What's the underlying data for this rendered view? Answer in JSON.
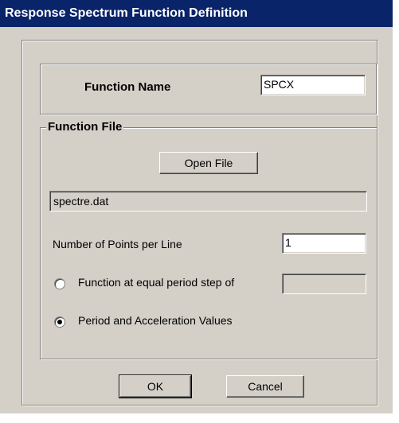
{
  "window": {
    "title": "Response Spectrum Function Definition"
  },
  "function_name": {
    "label": "Function Name",
    "value": "SPCX"
  },
  "function_file": {
    "group_label": "Function File",
    "open_button": "Open File",
    "filename": "spectre.dat",
    "points_label": "Number of Points per Line",
    "points_value": "1",
    "options": [
      {
        "label": "Function at equal period step of",
        "selected": false,
        "step_value": ""
      },
      {
        "label": "Period and Acceleration Values",
        "selected": true
      }
    ]
  },
  "buttons": {
    "ok": "OK",
    "cancel": "Cancel"
  }
}
